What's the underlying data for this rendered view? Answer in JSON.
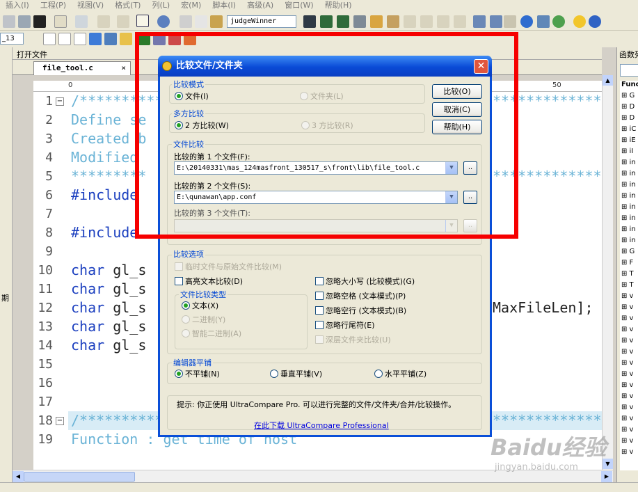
{
  "menubar": [
    "插入(I)",
    "工程(P)",
    "视图(V)",
    "格式(T)",
    "列(L)",
    "宏(M)",
    "脚本(I)",
    "高级(A)",
    "窗口(W)",
    "帮助(H)"
  ],
  "toolbar": {
    "find_value": "judgeWinner",
    "left_dropdown": "_13"
  },
  "left_panel_label": "期",
  "filetree_title": "打开文件",
  "right_panel": {
    "title": "函数列",
    "items": [
      "Func",
      "G",
      "D",
      "D",
      "iC",
      "iE",
      "iI",
      "in",
      "in",
      "in",
      "in",
      "in",
      "in",
      "in",
      "in",
      "G",
      "F",
      "T",
      "T",
      "v",
      "v",
      "v",
      "v",
      "v",
      "v",
      "v",
      "v",
      "v",
      "v",
      "v",
      "v",
      "v",
      "v",
      "v"
    ]
  },
  "file_tab": {
    "name": "file_tool.c",
    "close": "×"
  },
  "ruler": {
    "left": "0",
    "right": "50"
  },
  "code_lines": [
    {
      "n": "1",
      "text": "/**********",
      "style": "comment",
      "fold": "−"
    },
    {
      "n": "2",
      "text": "Define se",
      "style": "comment"
    },
    {
      "n": "3",
      "text": "Created b",
      "style": "comment"
    },
    {
      "n": "4",
      "text": "Modified ",
      "style": "comment"
    },
    {
      "n": "5",
      "text": "*********",
      "style": "comment"
    },
    {
      "n": "6",
      "text": "#include ",
      "style": "directive"
    },
    {
      "n": "7",
      "text": "",
      "style": "plain"
    },
    {
      "n": "8",
      "text": "#include ",
      "style": "directive"
    },
    {
      "n": "9",
      "text": "",
      "style": "plain"
    },
    {
      "n": "10",
      "text": "char gl_s",
      "style": "decl"
    },
    {
      "n": "11",
      "text": "char gl_s",
      "style": "decl"
    },
    {
      "n": "12",
      "text": "char gl_s",
      "style": "decl",
      "tail": "MaxFileLen];"
    },
    {
      "n": "13",
      "text": "char gl_s",
      "style": "decl"
    },
    {
      "n": "14",
      "text": "char gl_s",
      "style": "decl"
    },
    {
      "n": "15",
      "text": "",
      "style": "plain"
    },
    {
      "n": "16",
      "text": "",
      "style": "plain"
    },
    {
      "n": "17",
      "text": "",
      "style": "plain"
    },
    {
      "n": "18",
      "text": "/**********",
      "style": "comment",
      "fold": "−",
      "hl": true
    },
    {
      "n": "19",
      "text": "Function : get time of host",
      "style": "comment"
    }
  ],
  "stars_tail": "**************",
  "dialog": {
    "title": "比较文件/文件夹",
    "close": "✕",
    "compare_mode": {
      "label": "比较模式",
      "file": "文件(I)",
      "folder": "文件夹(L)"
    },
    "multi_compare": {
      "label": "多方比较",
      "two": "2 方比较(W)",
      "three": "3 方比较(R)"
    },
    "buttons": {
      "compare": "比较(O)",
      "cancel": "取消(C)",
      "help": "帮助(H)"
    },
    "file_compare": {
      "label": "文件比较",
      "file1_label": "比较的第 1 个文件(F):",
      "file1_value": "E:\\20140331\\mas_124masfront_130517_s\\front\\lib\\file_tool.c",
      "file2_label": "比较的第 2 个文件(S):",
      "file2_value": "E:\\qunawan\\app.conf",
      "file3_label": "比较的第 3 个文件(T):",
      "file3_value": "",
      "browse": ".."
    },
    "options": {
      "label": "比较选项",
      "temp_original": "临时文件与原始文件比较(M)",
      "highlight": "高亮文本比较(D)",
      "ignore_case": "忽略大小写 (比较模式)(G)",
      "ignore_space": "忽略空格 (文本模式)(P)",
      "ignore_blank": "忽略空行 (文本模式)(B)",
      "ignore_eol": "忽略行尾符(E)",
      "deep_folder": "深层文件夹比较(U)",
      "type_label": "文件比较类型",
      "type_text": "文本(X)",
      "type_binary": "二进制(Y)",
      "type_smart": "智能二进制(A)"
    },
    "tiling": {
      "label": "编辑器平铺",
      "none": "不平铺(N)",
      "vertical": "垂直平铺(V)",
      "horizontal": "水平平铺(Z)"
    },
    "hint": {
      "text": "提示: 你正使用 UltraCompare Pro. 可以进行完整的文件/文件夹/合并/比较操作。",
      "link": "在此下载 UltraCompare Professional"
    }
  },
  "watermark": {
    "brand": "Baidu经验",
    "url": "jingyan.baidu.com"
  },
  "colors": {
    "highlight_border": "#f60000",
    "dialog_blue": "#0a4fd8",
    "comment": "#6ab3d6",
    "keyword": "#1b3fbf"
  }
}
